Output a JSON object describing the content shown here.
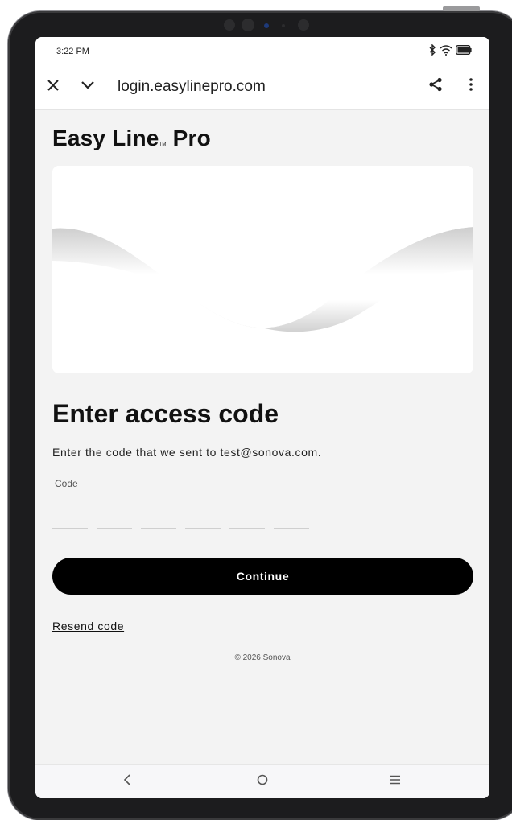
{
  "status_bar": {
    "time": "3:22 PM",
    "icons": [
      "bluetooth-icon",
      "wifi-icon",
      "battery-icon"
    ]
  },
  "browser": {
    "close_icon": "close-icon",
    "collapse_icon": "chevron-down-icon",
    "url": "login.easylinepro.com",
    "share_icon": "share-icon",
    "menu_icon": "more-vertical-icon"
  },
  "brand": {
    "name_part1": "Easy Line",
    "tm": "TM",
    "name_part2": "Pro"
  },
  "form": {
    "heading": "Enter access code",
    "description": "Enter the code that we sent to test@sonova.com.",
    "code_label": "Code",
    "code_slots": 6,
    "continue_label": "Continue",
    "resend_label": "Resend code"
  },
  "footer": {
    "copyright": "© 2026 Sonova"
  },
  "nav_bar": {
    "back_icon": "back-icon",
    "home_icon": "home-icon",
    "recents_icon": "recents-icon"
  },
  "colors": {
    "primary_button": "#000000",
    "page_background": "#f3f3f3"
  }
}
